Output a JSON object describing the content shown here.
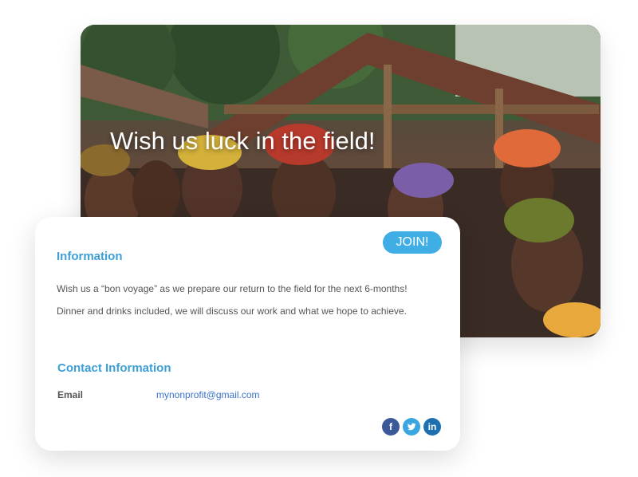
{
  "hero": {
    "title": "Wish us luck in the field!"
  },
  "card": {
    "join_label": "JOIN!",
    "info_heading": "Information",
    "info_lines": [
      "Wish us a “bon voyage” as we prepare our return to the field for the next 6-months!",
      "Dinner and drinks included, we will discuss our work and what we hope to achieve."
    ],
    "contact_heading": "Contact Information",
    "email_label": "Email",
    "email_value": "mynonprofit@gmail.com",
    "social": [
      {
        "icon": "facebook-icon",
        "glyph": "f"
      },
      {
        "icon": "twitter-icon",
        "glyph": "t"
      },
      {
        "icon": "linkedin-icon",
        "glyph": "in"
      }
    ]
  },
  "colors": {
    "accent": "#3eaee5",
    "heading": "#3d9fd6",
    "link": "#3a73c9"
  }
}
